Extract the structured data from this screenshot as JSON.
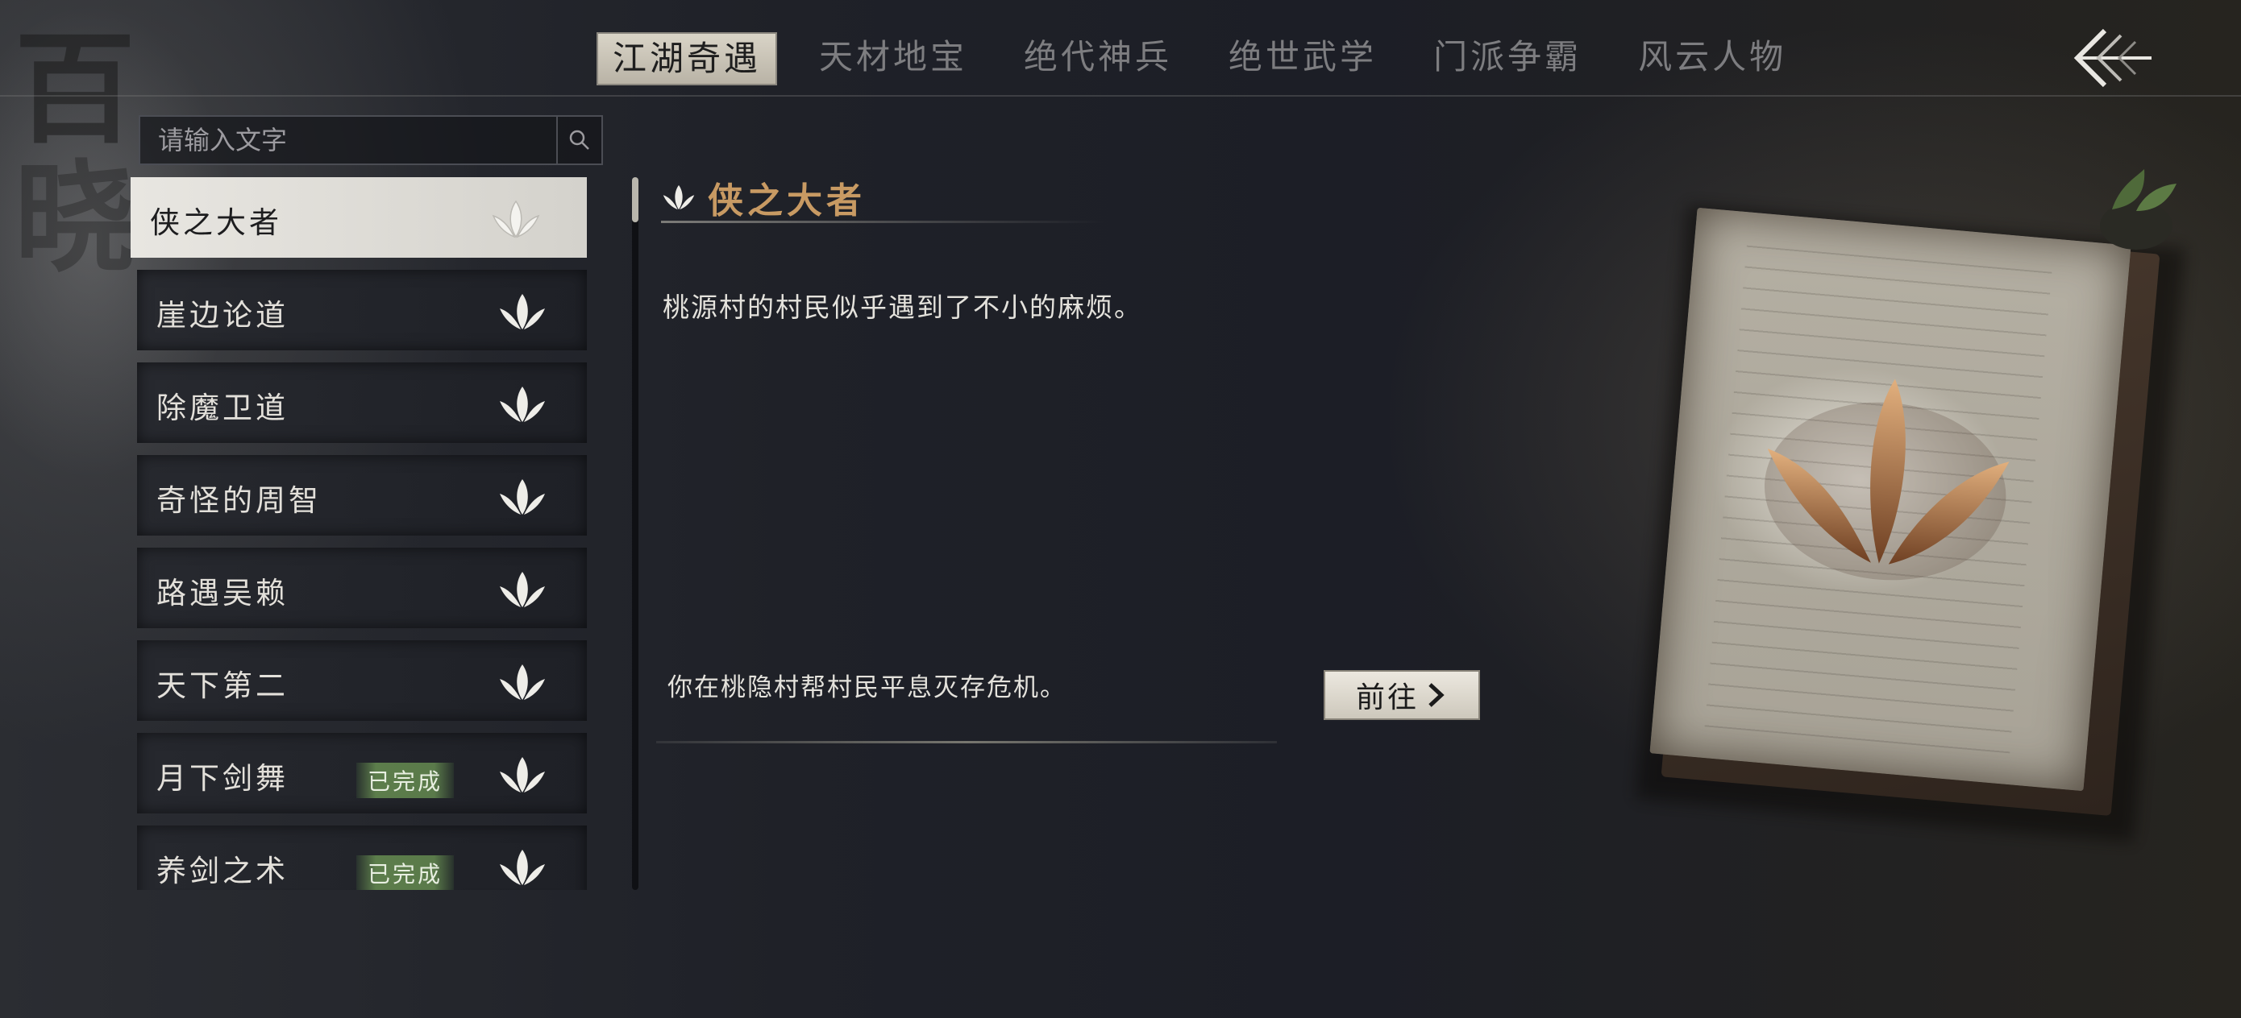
{
  "backdrop": {
    "calligraphy": [
      "百",
      "晓"
    ]
  },
  "nav": {
    "tabs": [
      {
        "label": "江湖奇遇",
        "active": true
      },
      {
        "label": "天材地宝",
        "active": false
      },
      {
        "label": "绝代神兵",
        "active": false
      },
      {
        "label": "绝世武学",
        "active": false
      },
      {
        "label": "门派争霸",
        "active": false
      },
      {
        "label": "风云人物",
        "active": false
      }
    ],
    "back_icon": "back-arrow-icon"
  },
  "search": {
    "placeholder": "请输入文字",
    "value": "",
    "icon": "search-icon"
  },
  "quests": [
    {
      "label": "侠之大者",
      "selected": true,
      "badge": ""
    },
    {
      "label": "崖边论道",
      "selected": false,
      "badge": ""
    },
    {
      "label": "除魔卫道",
      "selected": false,
      "badge": ""
    },
    {
      "label": "奇怪的周智",
      "selected": false,
      "badge": ""
    },
    {
      "label": "路遇吴赖",
      "selected": false,
      "badge": ""
    },
    {
      "label": "天下第二",
      "selected": false,
      "badge": ""
    },
    {
      "label": "月下剑舞",
      "selected": false,
      "badge": "已完成"
    },
    {
      "label": "养剑之术",
      "selected": false,
      "badge": "已完成"
    }
  ],
  "detail": {
    "title": "侠之大者",
    "description": "桃源村的村民似乎遇到了不小的麻烦。",
    "goal": "你在桃隐村帮村民平息灭存危机。",
    "goto_label": "前往",
    "title_color": "#c89a63"
  },
  "colors": {
    "accent": "#c89a63",
    "badge_green": "#5c7d4b",
    "selected_bg": "#e8e6e1"
  }
}
